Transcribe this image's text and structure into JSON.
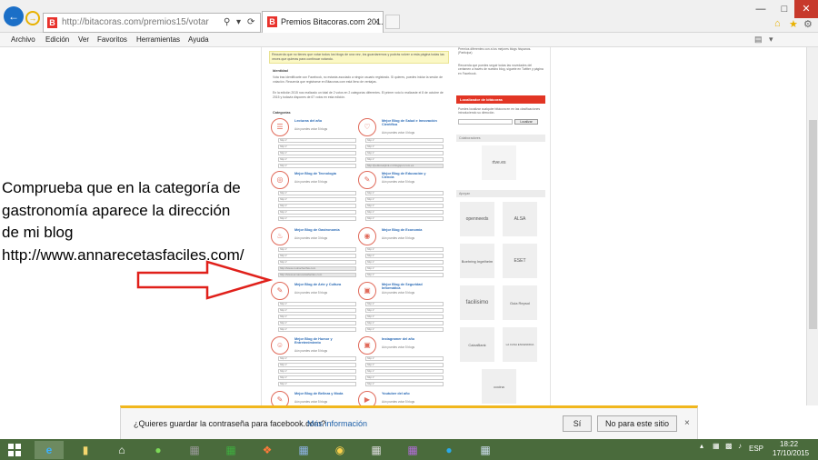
{
  "browser": {
    "url": "http://bitacoras.com/premios15/votar",
    "tab_title": "Premios Bitacoras.com 201...",
    "favicon_letter": "B",
    "back_icon": "arrow-left-icon",
    "forward_icon": "arrow-right-icon",
    "search_icon": "search-icon",
    "refresh_icon": "refresh-icon",
    "close_tab": "×",
    "home_icon": "home-icon",
    "star_icon": "star-icon",
    "gear_icon": "gear-icon",
    "minimize": "—",
    "maximize": "□",
    "close": "✕"
  },
  "menu": {
    "items": [
      "Archivo",
      "Edición",
      "Ver",
      "Favoritos",
      "Herramientas",
      "Ayuda"
    ]
  },
  "page": {
    "notice": "Recuerda que no tienes que votar todos los blogs de una vez, los guardaremos y podrás volver a esta página todas las veces que quieras para continuar votando.",
    "identity_title": "Identidad",
    "identity_text": "Vota tras identificarte con Facebook, no estarás asociado a ningún usuario registrado. Si quieres, puedes iniciar la sesión de votación. Recuerda que registrarse en Bitacoras.com está lleno de ventajas.",
    "edition_text": "En la edición 2015 nos realizado un total de 2 votos en 2 categorías diferentes. El primer voto lo realizaste el 8 de octubre de 2015 y todavía dispones de 67 votos en esta edición.",
    "categories_title": "Categorías",
    "vote_hint": "Aún puedes votar 5 blogs",
    "vote_hint_4": "Aún puedes votar 4 blogs",
    "vote_hint_3": "Aún puedes votar 3 blogs",
    "placeholder": "http://",
    "filled_1": "http://www.cuoliocherifav.com",
    "filled_2": "http://www.annarecetasfaciles.com",
    "filled_3": "http://petticoatpink-mi.blogspot.com.es",
    "categories_left": [
      "Lecturas del año",
      "Mejor Blog de Tecnología",
      "Mejor Blog de Gastronomía",
      "Mejor Blog de Arte y Cultura",
      "Mejor Blog de Humor y Entretenimiento",
      "Mejor Blog de Belleza y Moda"
    ],
    "categories_right": [
      "Mejor Blog de Salud e Innovación Científica",
      "Mejor Blog de Educación y Ciencia",
      "Mejor Blog de Economía",
      "Mejor Blog de Seguridad Informática",
      "Instagramer del año",
      "Youtuber del año"
    ],
    "sidebar_top_text": "Premios diferentes con a los mejores blogs hispanos. (Participa)",
    "sidebar_text_2": "Recuerda que puedes seguir todas las novedades del certamen a través de nuestro blog, síguete en Twitter y página en Facebook.",
    "locator_title": "Localizador de bitácoras",
    "locator_text": "Puedes localizar cualquier bitácora en en las clasificaciones introduciendo su dirección.",
    "locator_button": "Localizar",
    "collaborators_title": "Colaboradores",
    "supporters_title": "Apoyan",
    "logos": [
      "rtve.es",
      "openneeds",
      "ALSA",
      "Boehring Ingelheim",
      "ESET",
      "facilisimo",
      "Guia Repsol",
      "CaixaBank",
      "LA CASA ENCENDIDA",
      "cocina"
    ]
  },
  "annotation": {
    "line1": "Comprueba que en la categoría de",
    "line2": "gastronomía aparece la dirección",
    "line3": "de mi blog",
    "line4": "http://www.annarecetasfaciles.com/",
    "arrow_color": "#e0201a"
  },
  "notification": {
    "question": "¿Quieres guardar la contraseña para facebook.com?",
    "more_info": "Más información",
    "yes": "Sí",
    "no": "No para este sitio",
    "close": "×",
    "accent": "#f1b71d"
  },
  "taskbar": {
    "icons": [
      "windows-start-icon",
      "internet-explorer-icon",
      "file-explorer-icon",
      "home-icon",
      "spotify-icon",
      "excel-icon",
      "app-icon",
      "app-icon",
      "chrome-icon",
      "app-icon",
      "onenote-icon",
      "skype-icon",
      "word-icon"
    ],
    "language": "ESP",
    "time": "18:22",
    "date": "17/10/2015",
    "color": "#4a6b3c"
  }
}
